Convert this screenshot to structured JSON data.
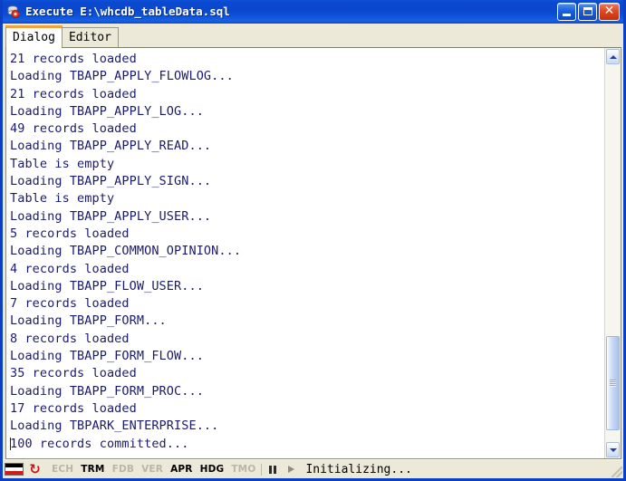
{
  "window": {
    "title": "Execute E:\\whcdb_tableData.sql",
    "icon": "database-execute-icon",
    "minimize_label": "",
    "maximize_label": "",
    "close_label": "✕"
  },
  "tabs": [
    {
      "label": "Dialog",
      "active": true
    },
    {
      "label": "Editor",
      "active": false
    }
  ],
  "log": {
    "lines": [
      "21 records loaded",
      "Loading TBAPP_APPLY_FLOWLOG...",
      "21 records loaded",
      "Loading TBAPP_APPLY_LOG...",
      "49 records loaded",
      "Loading TBAPP_APPLY_READ...",
      "Table is empty",
      "Loading TBAPP_APPLY_SIGN...",
      "Table is empty",
      "Loading TBAPP_APPLY_USER...",
      "5 records loaded",
      "Loading TBAPP_COMMON_OPINION...",
      "4 records loaded",
      "Loading TBAPP_FLOW_USER...",
      "7 records loaded",
      "Loading TBAPP_FORM...",
      "8 records loaded",
      "Loading TBAPP_FORM_FLOW...",
      "35 records loaded",
      "Loading TBAPP_FORM_PROC...",
      "17 records loaded",
      "Loading TBPARK_ENTERPRISE...",
      "100 records committed..."
    ],
    "caret_line_index": 22,
    "text_color": "#1b1b6e",
    "background_color": "#ffffff"
  },
  "scrollbar": {
    "up_arrow": "chevron-up-icon",
    "down_arrow": "chevron-down-icon",
    "thumb_top_percent": 72,
    "thumb_height_percent": 25
  },
  "statusbar": {
    "flag_icon": "country-flag-icon",
    "refresh_icon": "↻",
    "indicators": [
      {
        "label": "ECH",
        "enabled": false
      },
      {
        "label": "TRM",
        "enabled": true
      },
      {
        "label": "FDB",
        "enabled": false
      },
      {
        "label": "VER",
        "enabled": false
      },
      {
        "label": "APR",
        "enabled": true
      },
      {
        "label": "HDG",
        "enabled": true
      },
      {
        "label": "TMO",
        "enabled": false
      }
    ],
    "pause_icon": "pause-icon",
    "play_icon": "play-icon",
    "message": "Initializing..."
  },
  "colors": {
    "titlebar_blue": "#0a47cd",
    "frame_blue": "#0b3fc4",
    "client_beige": "#ece9d8",
    "tab_accent_orange": "#f3a13c",
    "log_text": "#1b1b6e",
    "close_red": "#c32f0c"
  }
}
